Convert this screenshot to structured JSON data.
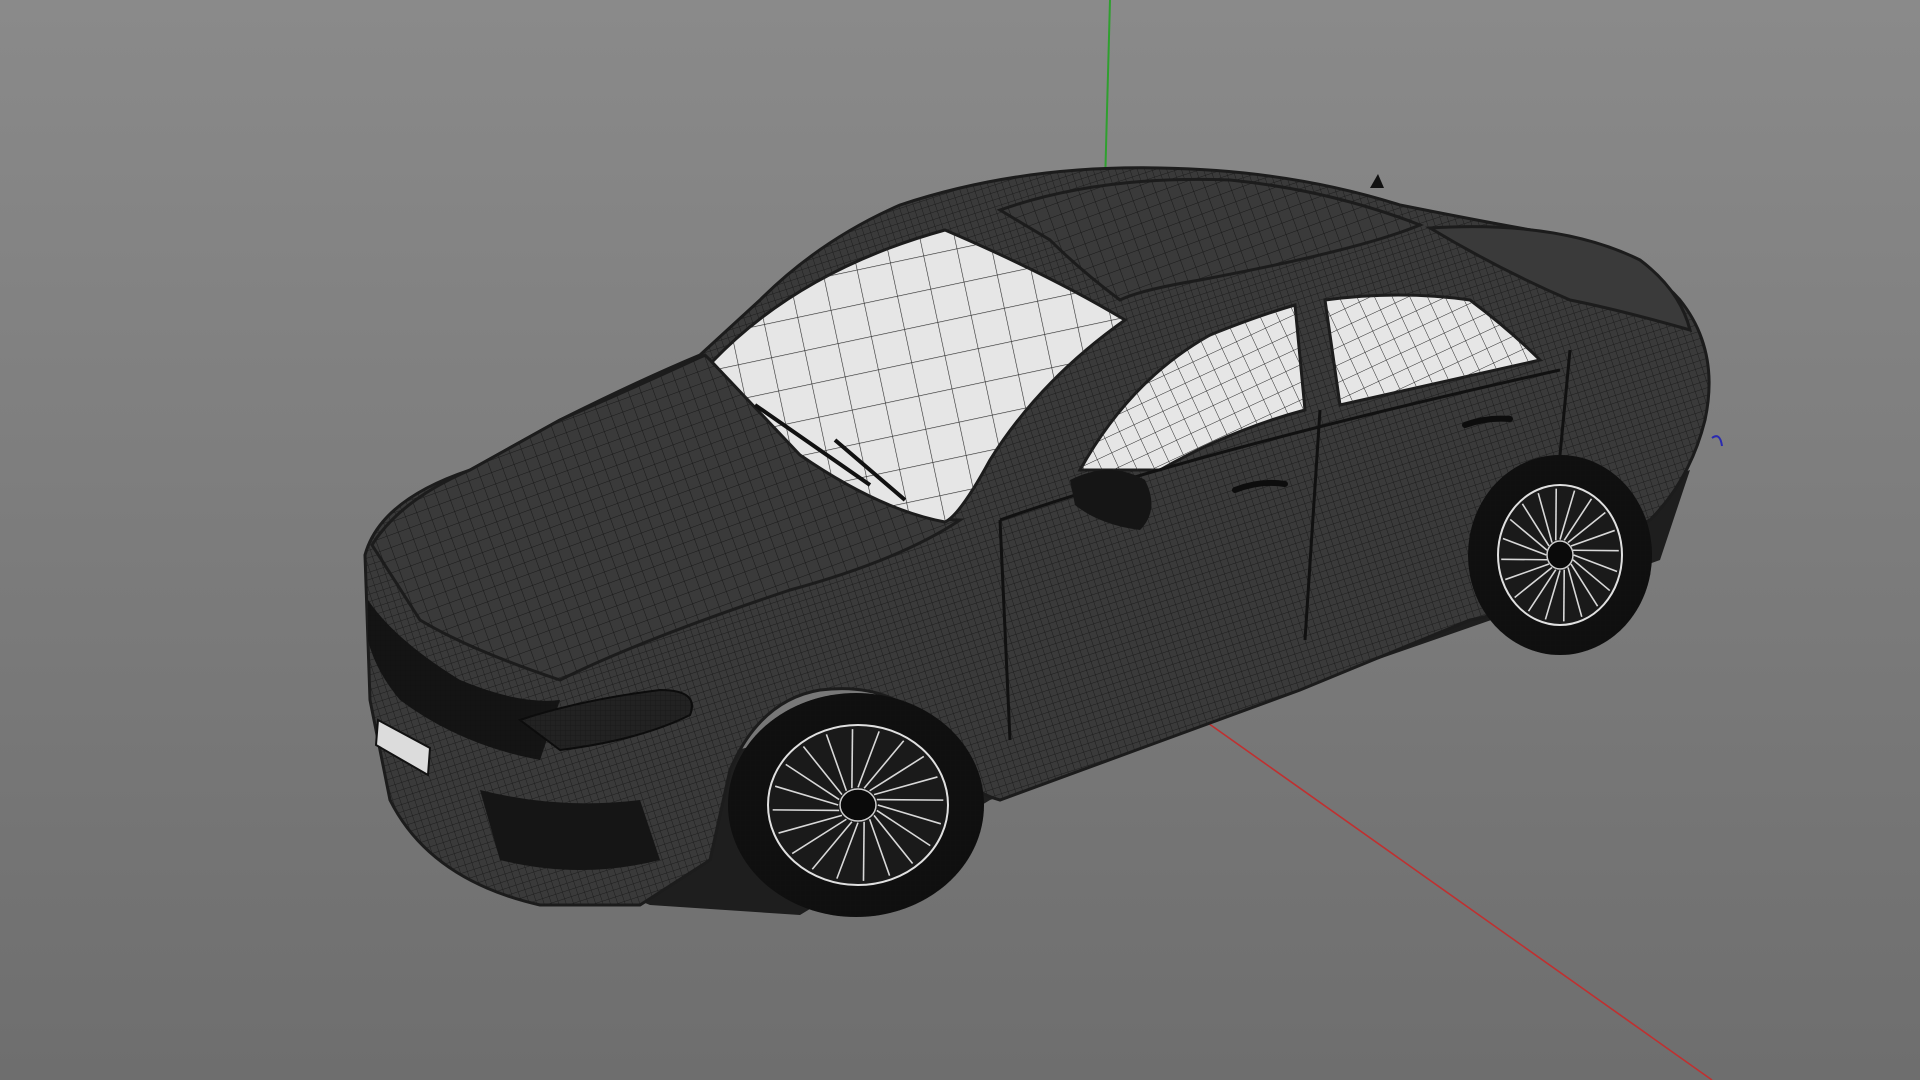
{
  "viewport": {
    "view": "perspective",
    "render_mode": "wireframe",
    "background_top_color": "#8a8a8a",
    "background_bottom_color": "#6e6e6e"
  },
  "axes": {
    "x_axis_color": "#c03030",
    "y_axis_color": "#2fa02f",
    "z_axis_color": "#2a2ab0"
  },
  "model": {
    "object": "sedan-car",
    "wire_color": "#1c1c1c",
    "body_fill_color": "#3a3a3a",
    "glass_fill_color": "#e6e6e6"
  }
}
